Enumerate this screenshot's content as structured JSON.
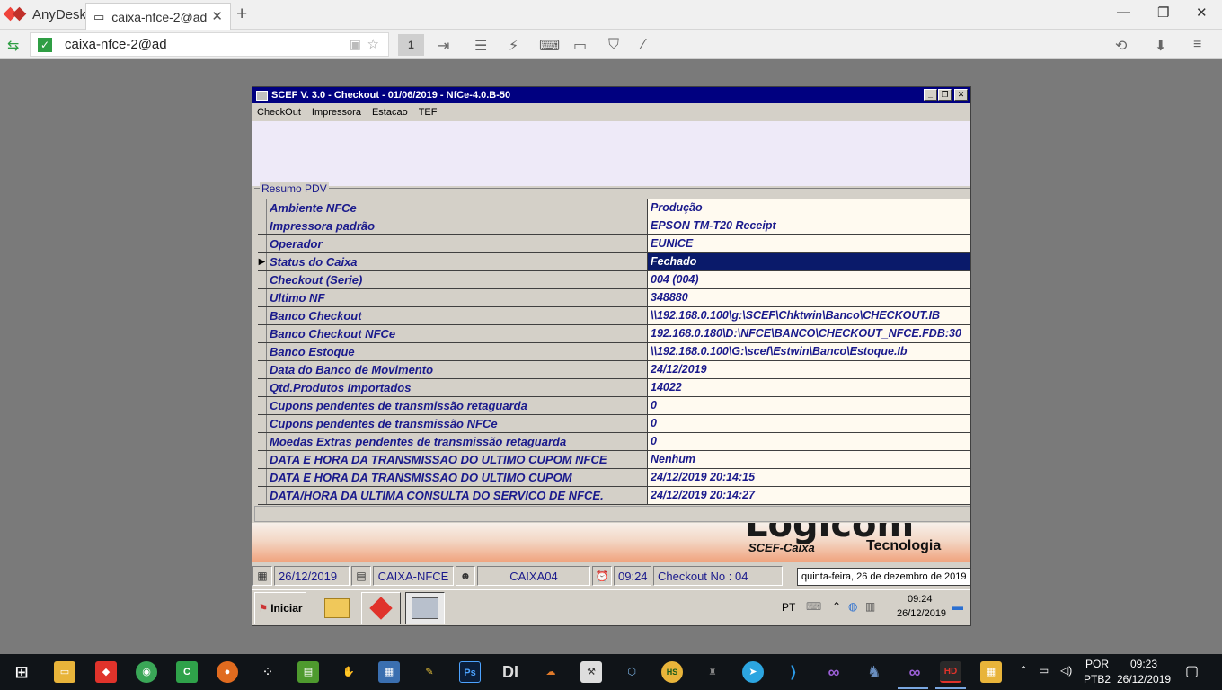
{
  "anydesk": {
    "app_name": "AnyDesk",
    "tab_title": "caixa-nfce-2@ad",
    "address": "caixa-nfce-2@ad",
    "monitor_badge": "1"
  },
  "window": {
    "title": "SCEF V.  3.0 - Checkout - 01/06/2019 - NfCe-4.0.B-50",
    "menu": [
      "CheckOut",
      "Impressora",
      "Estacao",
      "TEF"
    ]
  },
  "resumo": {
    "group_title": "Resumo PDV",
    "selected_index": 3,
    "rows": [
      {
        "label": "Ambiente NFCe",
        "value": "Produção"
      },
      {
        "label": "Impressora padrão",
        "value": "EPSON TM-T20 Receipt"
      },
      {
        "label": "Operador",
        "value": "EUNICE"
      },
      {
        "label": "Status do Caixa",
        "value": "Fechado"
      },
      {
        "label": "Checkout (Serie)",
        "value": "004 (004)"
      },
      {
        "label": "Ultimo NF",
        "value": "348880"
      },
      {
        "label": "Banco Checkout",
        "value": "\\\\192.168.0.100\\g:\\SCEF\\Chktwin\\Banco\\CHECKOUT.IB"
      },
      {
        "label": "Banco Checkout NFCe",
        "value": "192.168.0.180\\D:\\NFCE\\BANCO\\CHECKOUT_NFCE.FDB:30"
      },
      {
        "label": "Banco Estoque",
        "value": "\\\\192.168.0.100\\G:\\scef\\Estwin\\Banco\\Estoque.Ib"
      },
      {
        "label": "Data do Banco de Movimento",
        "value": "24/12/2019"
      },
      {
        "label": "Qtd.Produtos Importados",
        "value": "14022"
      },
      {
        "label": "Cupons pendentes de transmissão retaguarda",
        "value": "0"
      },
      {
        "label": "Cupons pendentes de transmissão NFCe",
        "value": "0"
      },
      {
        "label": "Moedas Extras pendentes de transmissão retaguarda",
        "value": "0"
      },
      {
        "label": "DATA E HORA DA TRANSMISSAO DO ULTIMO CUPOM NFCE",
        "value": "Nenhum"
      },
      {
        "label": "DATA E HORA DA TRANSMISSAO DO ULTIMO CUPOM",
        "value": "24/12/2019 20:14:15"
      },
      {
        "label": "DATA/HORA DA ULTIMA CONSULTA DO SERVICO DE NFCE.",
        "value": "24/12/2019 20:14:27"
      }
    ]
  },
  "banner": {
    "logo": "Logicom",
    "sub": "SCEF-Caixa",
    "tec": "Tecnologia"
  },
  "statusbar": {
    "date": "26/12/2019",
    "station": "CAIXA-NFCE",
    "caixa": "CAIXA04",
    "time": "09:24",
    "checkout": "Checkout No : 04",
    "tooltip": "quinta-feira, 26 de dezembro de 2019"
  },
  "remote_taskbar": {
    "start_label": "Iniciar",
    "lang": "PT",
    "clock_time": "09:24",
    "clock_date": "26/12/2019"
  },
  "windows_taskbar": {
    "lang_top": "POR",
    "lang_bottom": "PTB2",
    "time": "09:23",
    "date": "26/12/2019"
  }
}
